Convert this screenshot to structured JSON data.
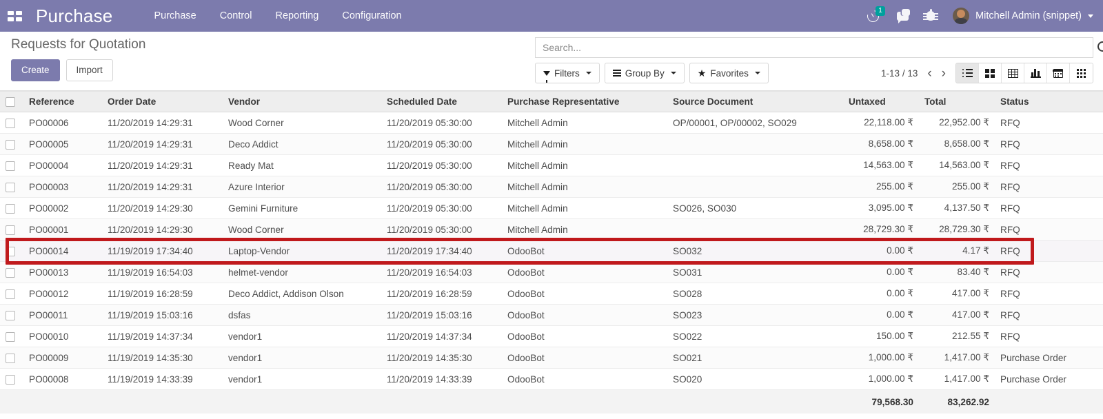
{
  "navbar": {
    "apps_icon": "apps-grid-icon",
    "brand": "Purchase",
    "menus": [
      "Purchase",
      "Control",
      "Reporting",
      "Configuration"
    ],
    "activity_icon": "clock-icon",
    "activity_count": "1",
    "messages_icon": "chat-bubble-icon",
    "debug_icon": "bug-icon",
    "user_name": "Mitchell Admin (snippet)",
    "brand_color": "#7C7BAD"
  },
  "control_panel": {
    "breadcrumb": "Requests for Quotation",
    "create_label": "Create",
    "import_label": "Import",
    "search_placeholder": "Search...",
    "search_value": "",
    "search_icon": "magnifier-icon",
    "filters_label": "Filters",
    "group_by_label": "Group By",
    "favorites_label": "Favorites",
    "pager_label": "1-13 / 13",
    "prev_glyph": "‹",
    "next_glyph": "›",
    "star_glyph": "★",
    "views": [
      {
        "name": "list-view",
        "active": true
      },
      {
        "name": "kanban-view",
        "active": false
      },
      {
        "name": "pivot-view",
        "active": false
      },
      {
        "name": "graph-view",
        "active": false
      },
      {
        "name": "calendar-view",
        "active": false
      },
      {
        "name": "activity-view",
        "active": false
      }
    ]
  },
  "table": {
    "columns": [
      "Reference",
      "Order Date",
      "Vendor",
      "Scheduled Date",
      "Purchase Representative",
      "Source Document",
      "Untaxed",
      "Total",
      "Status"
    ],
    "rows": [
      {
        "reference": "PO00006",
        "order_date": "11/20/2019 14:29:31",
        "vendor": "Wood Corner",
        "scheduled_date": "11/20/2019 05:30:00",
        "representative": "Mitchell Admin",
        "source_document": "OP/00001, OP/00002, SO029",
        "untaxed": "22,118.00 ₹",
        "total": "22,952.00 ₹",
        "status": "RFQ"
      },
      {
        "reference": "PO00005",
        "order_date": "11/20/2019 14:29:31",
        "vendor": "Deco Addict",
        "scheduled_date": "11/20/2019 05:30:00",
        "representative": "Mitchell Admin",
        "source_document": "",
        "untaxed": "8,658.00 ₹",
        "total": "8,658.00 ₹",
        "status": "RFQ"
      },
      {
        "reference": "PO00004",
        "order_date": "11/20/2019 14:29:31",
        "vendor": "Ready Mat",
        "scheduled_date": "11/20/2019 05:30:00",
        "representative": "Mitchell Admin",
        "source_document": "",
        "untaxed": "14,563.00 ₹",
        "total": "14,563.00 ₹",
        "status": "RFQ"
      },
      {
        "reference": "PO00003",
        "order_date": "11/20/2019 14:29:31",
        "vendor": "Azure Interior",
        "scheduled_date": "11/20/2019 05:30:00",
        "representative": "Mitchell Admin",
        "source_document": "",
        "untaxed": "255.00 ₹",
        "total": "255.00 ₹",
        "status": "RFQ"
      },
      {
        "reference": "PO00002",
        "order_date": "11/20/2019 14:29:30",
        "vendor": "Gemini Furniture",
        "scheduled_date": "11/20/2019 05:30:00",
        "representative": "Mitchell Admin",
        "source_document": "SO026, SO030",
        "untaxed": "3,095.00 ₹",
        "total": "4,137.50 ₹",
        "status": "RFQ"
      },
      {
        "reference": "PO00001",
        "order_date": "11/20/2019 14:29:30",
        "vendor": "Wood Corner",
        "scheduled_date": "11/20/2019 05:30:00",
        "representative": "Mitchell Admin",
        "source_document": "",
        "untaxed": "28,729.30 ₹",
        "total": "28,729.30 ₹",
        "status": "RFQ"
      },
      {
        "reference": "PO00014",
        "order_date": "11/19/2019 17:34:40",
        "vendor": "Laptop-Vendor",
        "scheduled_date": "11/20/2019 17:34:40",
        "representative": "OdooBot",
        "source_document": "SO032",
        "untaxed": "0.00 ₹",
        "total": "4.17 ₹",
        "status": "RFQ"
      },
      {
        "reference": "PO00013",
        "order_date": "11/19/2019 16:54:03",
        "vendor": "helmet-vendor",
        "scheduled_date": "11/20/2019 16:54:03",
        "representative": "OdooBot",
        "source_document": "SO031",
        "untaxed": "0.00 ₹",
        "total": "83.40 ₹",
        "status": "RFQ"
      },
      {
        "reference": "PO00012",
        "order_date": "11/19/2019 16:28:59",
        "vendor": "Deco Addict, Addison Olson",
        "scheduled_date": "11/20/2019 16:28:59",
        "representative": "OdooBot",
        "source_document": "SO028",
        "untaxed": "0.00 ₹",
        "total": "417.00 ₹",
        "status": "RFQ"
      },
      {
        "reference": "PO00011",
        "order_date": "11/19/2019 15:03:16",
        "vendor": "dsfas",
        "scheduled_date": "11/20/2019 15:03:16",
        "representative": "OdooBot",
        "source_document": "SO023",
        "untaxed": "0.00 ₹",
        "total": "417.00 ₹",
        "status": "RFQ"
      },
      {
        "reference": "PO00010",
        "order_date": "11/19/2019 14:37:34",
        "vendor": "vendor1",
        "scheduled_date": "11/20/2019 14:37:34",
        "representative": "OdooBot",
        "source_document": "SO022",
        "untaxed": "150.00 ₹",
        "total": "212.55 ₹",
        "status": "RFQ"
      },
      {
        "reference": "PO00009",
        "order_date": "11/19/2019 14:35:30",
        "vendor": "vendor1",
        "scheduled_date": "11/20/2019 14:35:30",
        "representative": "OdooBot",
        "source_document": "SO021",
        "untaxed": "1,000.00 ₹",
        "total": "1,417.00 ₹",
        "status": "Purchase Order"
      },
      {
        "reference": "PO00008",
        "order_date": "11/19/2019 14:33:39",
        "vendor": "vendor1",
        "scheduled_date": "11/20/2019 14:33:39",
        "representative": "OdooBot",
        "source_document": "SO020",
        "untaxed": "1,000.00 ₹",
        "total": "1,417.00 ₹",
        "status": "Purchase Order"
      }
    ],
    "footer": {
      "untaxed_total": "79,568.30",
      "grand_total": "83,262.92"
    }
  },
  "annotation": {
    "highlight_row_reference": "PO00014",
    "color": "#C0191C"
  }
}
